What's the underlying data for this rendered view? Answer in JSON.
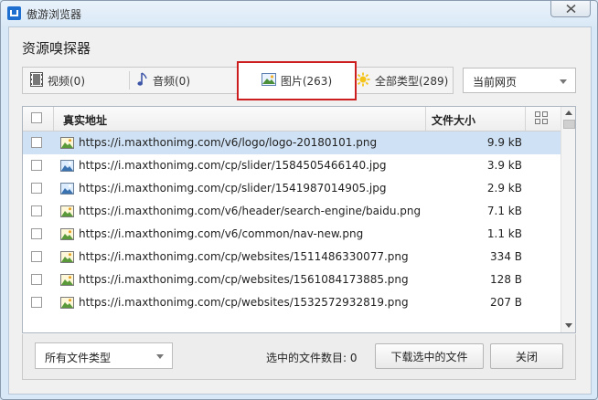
{
  "window": {
    "title": "傲游浏览器"
  },
  "dialog": {
    "title": "资源嗅探器"
  },
  "tabs": [
    {
      "label": "视频(0)",
      "icon": "film-icon"
    },
    {
      "label": "音频(0)",
      "icon": "music-note-icon"
    },
    {
      "label": "图片(263)",
      "icon": "picture-icon",
      "active": true
    },
    {
      "label": "全部类型(289)",
      "icon": "sunburst-icon"
    }
  ],
  "scope_select": {
    "value": "当前网页"
  },
  "table": {
    "columns": [
      "真实地址",
      "文件大小"
    ],
    "rows": [
      {
        "url": "https://i.maxthonimg.com/v6/logo/logo-20180101.png",
        "size": "9.9 kB",
        "icon": "png-image-icon",
        "selected": true
      },
      {
        "url": "https://i.maxthonimg.com/cp/slider/1584505466140.jpg",
        "size": "3.9 kB",
        "icon": "jpg-image-icon"
      },
      {
        "url": "https://i.maxthonimg.com/cp/slider/1541987014905.jpg",
        "size": "2.9 kB",
        "icon": "jpg-image-icon"
      },
      {
        "url": "https://i.maxthonimg.com/v6/header/search-engine/baidu.png",
        "size": "7.1 kB",
        "icon": "png-image-icon"
      },
      {
        "url": "https://i.maxthonimg.com/v6/common/nav-new.png",
        "size": "1.1 kB",
        "icon": "png-image-icon"
      },
      {
        "url": "https://i.maxthonimg.com/cp/websites/1511486330077.png",
        "size": "334 B",
        "icon": "png-image-icon"
      },
      {
        "url": "https://i.maxthonimg.com/cp/websites/1561084173885.png",
        "size": "128 B",
        "icon": "png-image-icon"
      },
      {
        "url": "https://i.maxthonimg.com/cp/websites/1532572932819.png",
        "size": "207 B",
        "icon": "png-image-icon"
      }
    ]
  },
  "footer": {
    "filter_value": "所有文件类型",
    "selected_count_label": "选中的文件数目: 0",
    "download_label": "下载选中的文件",
    "close_label": "关闭"
  },
  "colors": {
    "selected_row": "#cfe1f4",
    "active_tab_border": "#cc1e1e",
    "title_icon": "#1f6fd0"
  }
}
